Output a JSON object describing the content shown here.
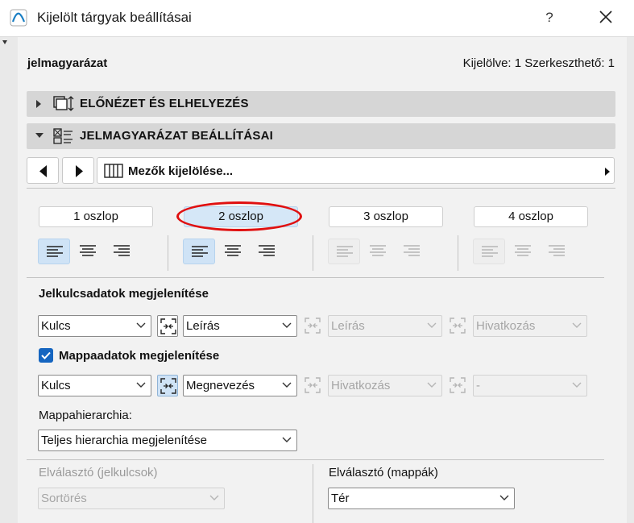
{
  "window": {
    "title": "Kijelölt tárgyak beállításai",
    "help": "?"
  },
  "header": {
    "name": "jelmagyarázat",
    "count": "Kijelölve: 1 Szerkeszthető: 1"
  },
  "sections": {
    "preview": "ELŐNÉZET ÉS ELHELYEZÉS",
    "legend": "JELMAGYARÁZAT BEÁLLÍTÁSAI"
  },
  "fields_selector": {
    "label": "Mezők kijelölése..."
  },
  "columns": [
    "1 oszlop",
    "2 oszlop",
    "3 oszlop",
    "4 oszlop"
  ],
  "active_column": "2 oszlop",
  "key_data": {
    "title": "Jelkulcsadatok megjelenítése",
    "dropdowns": [
      "Kulcs",
      "Leírás",
      "Leírás",
      "Hivatkozás"
    ]
  },
  "folder_data": {
    "title": "Mappaadatok megjelenítése",
    "checked": true,
    "dropdowns": [
      "Kulcs",
      "Megnevezés",
      "Hivatkozás",
      "-"
    ]
  },
  "hierarchy": {
    "label": "Mappahierarchia:",
    "value": "Teljes hierarchia megjelenítése"
  },
  "separator_keys": {
    "label": "Elválasztó (jelkulcsok)",
    "value": "Sortörés"
  },
  "separator_folders": {
    "label": "Elválasztó (mappák)",
    "value": "Tér"
  },
  "colors": {
    "accent": "#1565c0",
    "highlight": "#e01010",
    "selected_bg": "#cfe3f6"
  }
}
